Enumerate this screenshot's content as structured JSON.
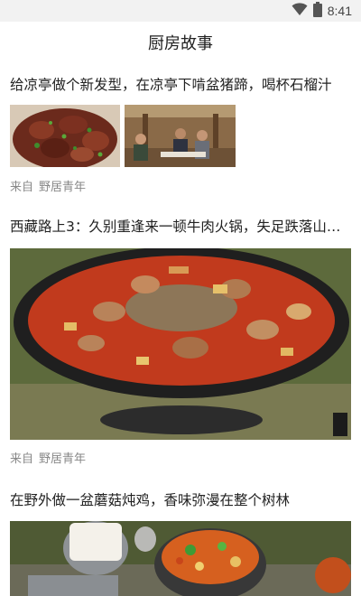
{
  "status_bar": {
    "time": "8:41",
    "icons": [
      "wifi-icon",
      "battery-icon"
    ]
  },
  "header": {
    "title": "厨房故事"
  },
  "articles": [
    {
      "title": "给凉亭做个新发型，在凉亭下啃盆猪蹄，喝杯石榴汁",
      "source_prefix": "来自",
      "source_name": "野居青年",
      "images": [
        "braised-pork-trotters-image",
        "people-in-pavilion-image"
      ]
    },
    {
      "title": "西藏路上3：久别重逢来一顿牛肉火锅，失足跌落山…",
      "source_prefix": "来自",
      "source_name": "野居青年",
      "images": [
        "beef-hotpot-wok-image"
      ]
    },
    {
      "title": "在野外做一盆蘑菇炖鸡，香味弥漫在整个树林",
      "images": [
        "mushroom-chicken-stew-image"
      ]
    }
  ]
}
